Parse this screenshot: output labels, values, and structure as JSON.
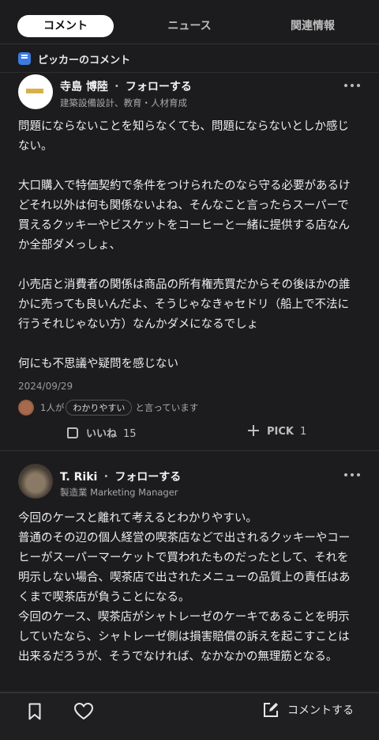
{
  "tabs": [
    {
      "label": "コメント",
      "active": true
    },
    {
      "label": "ニュース",
      "active": false
    },
    {
      "label": "関連情報",
      "active": false
    }
  ],
  "section": {
    "label": "ピッカーのコメント",
    "icon": "comment-bubble-icon",
    "icon_color": "#3d7be0"
  },
  "comments": [
    {
      "name": "寺島 博陸",
      "follow_label": "フォローする",
      "subtitle": "建築設備設計、教育・人材育成",
      "paragraphs": [
        "問題にならないことを知らなくても、問題にならないとしか感じない。",
        "大口購入で特価契約で条件をつけられたのなら守る必要があるけどそれ以外は何も関係ないよね、そんなこと言ったらスーパーで買えるクッキーやビスケットをコーヒーと一緒に提供する店なんか全部ダメっしょ、",
        "小売店と消費者の関係は商品の所有権売買だからその後ほかの誰かに売っても良いんだよ、そうじゃなきゃセドリ（船上で不法に行うそれじゃない方）なんかダメになるでしょ",
        "何にも不思議や疑問を感じない"
      ],
      "date": "2024/09/29",
      "likers_prefix": "1人が",
      "likers_chip": "わかりやすい",
      "likers_suffix": "と言っています",
      "like_label": "いいね",
      "like_count": "15",
      "pick_label": "PICK",
      "pick_count": "1"
    },
    {
      "name": "T. Riki",
      "follow_label": "フォローする",
      "subtitle": "製造業 Marketing Manager",
      "paragraphs": [
        "今回のケースと離れて考えるとわかりやすい。",
        "普通のその辺の個人経営の喫茶店などで出されるクッキーやコーヒーがスーパーマーケットで買われたものだったとして、それを明示しない場合、喫茶店で出されたメニューの品質上の責任はあくまで喫茶店が負うことになる。",
        "今回のケース、喫茶店がシャトレーゼのケーキであることを明示していたなら、シャトレーゼ側は損害賠償の訴えを起こすことは出来るだろうが、そうでなければ、なかなかの無理筋となる。"
      ]
    }
  ],
  "bottom": {
    "comment_label": "コメントする",
    "bookmark_icon": "bookmark-icon",
    "heart_icon": "heart-icon",
    "edit_icon": "edit-icon"
  }
}
